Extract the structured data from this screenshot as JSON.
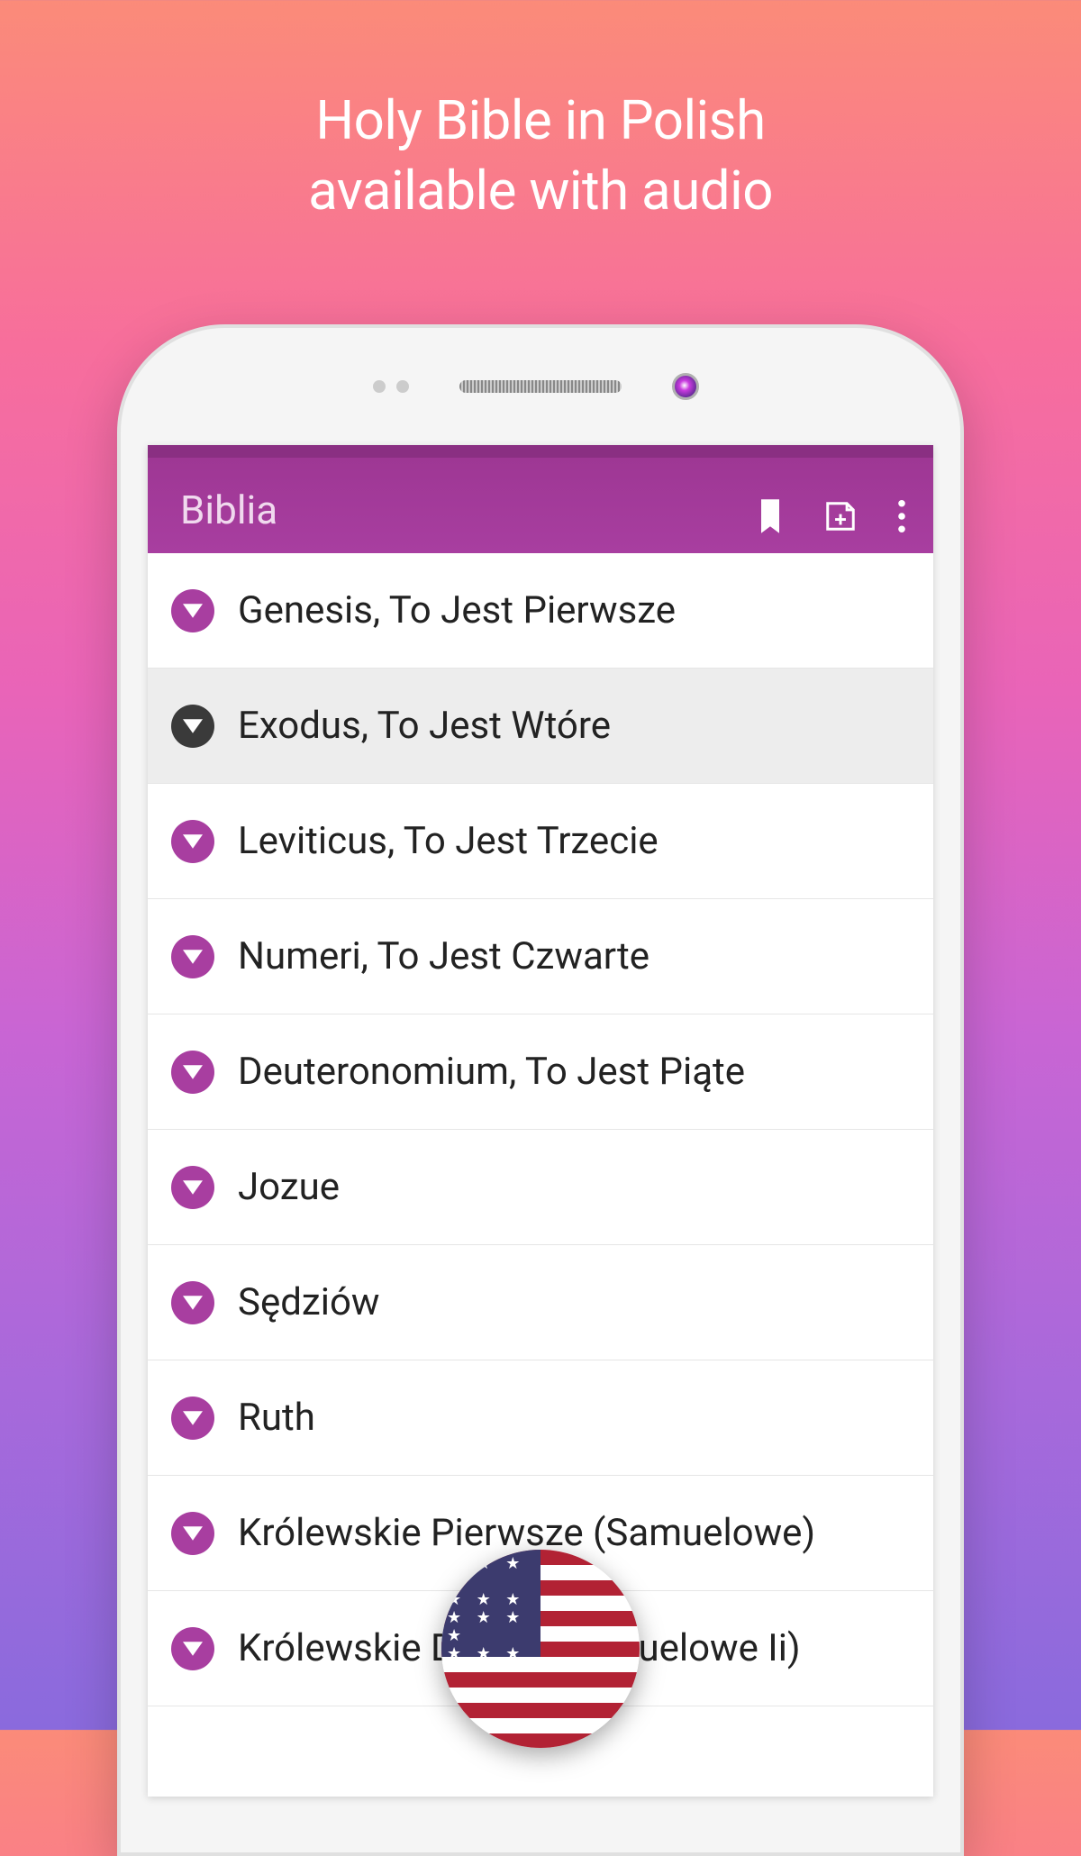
{
  "promo": {
    "line1": "Holy Bible in Polish",
    "line2": "available with audio"
  },
  "appbar": {
    "title": "Biblia"
  },
  "books": [
    {
      "label": "Genesis, To Jest Pierwsze",
      "selected": false
    },
    {
      "label": "Exodus, To Jest Wtóre",
      "selected": true
    },
    {
      "label": "Leviticus, To Jest Trzecie",
      "selected": false
    },
    {
      "label": "Numeri, To Jest Czwarte",
      "selected": false
    },
    {
      "label": "Deuteronomium, To Jest Piąte",
      "selected": false
    },
    {
      "label": "Jozue",
      "selected": false
    },
    {
      "label": "Sędziów",
      "selected": false
    },
    {
      "label": "Ruth",
      "selected": false
    },
    {
      "label": "Królewskie Pierwsze (Samuelowe)",
      "selected": false
    },
    {
      "label": "Królewskie Drugie (Samuelowe Ii)",
      "selected": false
    }
  ],
  "flag": {
    "country": "us"
  }
}
